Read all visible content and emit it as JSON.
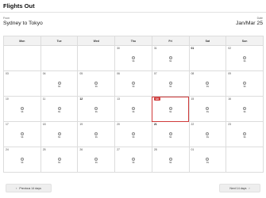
{
  "header": {
    "title": "Flights Out",
    "from_label": "From",
    "date_label": "Date",
    "route": "Sydney to Tokyo",
    "date_range": "Jan/Mar 25"
  },
  "calendar": {
    "weekdays": [
      "Mon",
      "Tue",
      "Wed",
      "Thu",
      "Fri",
      "Sat",
      "Sun"
    ],
    "price_marker": "$$",
    "weeks": [
      [
        {
          "day": ""
        },
        {
          "day": ""
        },
        {
          "day": ""
        },
        {
          "day": "30",
          "price": true
        },
        {
          "day": "31",
          "price": true
        },
        {
          "day": "01",
          "bold": true
        },
        {
          "day": "02",
          "price": true
        }
      ],
      [
        {
          "day": "03"
        },
        {
          "day": "04",
          "price": true
        },
        {
          "day": "05",
          "price": true
        },
        {
          "day": "06",
          "price": true
        },
        {
          "day": "07",
          "price": true
        },
        {
          "day": "08",
          "price": true
        },
        {
          "day": "09",
          "price": true
        }
      ],
      [
        {
          "day": "10",
          "price": true
        },
        {
          "day": "11",
          "price": true
        },
        {
          "day": "12",
          "bold": true,
          "price": true
        },
        {
          "day": "13",
          "price": true
        },
        {
          "day": "14",
          "selected": true,
          "price": true
        },
        {
          "day": "15",
          "price": true
        },
        {
          "day": "16",
          "price": true
        }
      ],
      [
        {
          "day": "17",
          "price": true
        },
        {
          "day": "18",
          "price": true
        },
        {
          "day": "19",
          "price": true
        },
        {
          "day": "20",
          "price": true
        },
        {
          "day": "21",
          "bold": true,
          "price": true
        },
        {
          "day": "22",
          "price": true
        },
        {
          "day": "23",
          "price": true
        }
      ],
      [
        {
          "day": "24",
          "price": true
        },
        {
          "day": "25",
          "price": true
        },
        {
          "day": "26",
          "price": true
        },
        {
          "day": "27",
          "price": true
        },
        {
          "day": "28",
          "price": true
        },
        {
          "day": "01",
          "price": true
        },
        {
          "day": ""
        }
      ]
    ]
  },
  "nav": {
    "prev_label": "Previous 14 days",
    "next_label": "Next 14 days"
  },
  "colors": {
    "selected": "#d03a3a",
    "header_bg": "#f2f2f2",
    "button_bg": "#eeeeee"
  }
}
